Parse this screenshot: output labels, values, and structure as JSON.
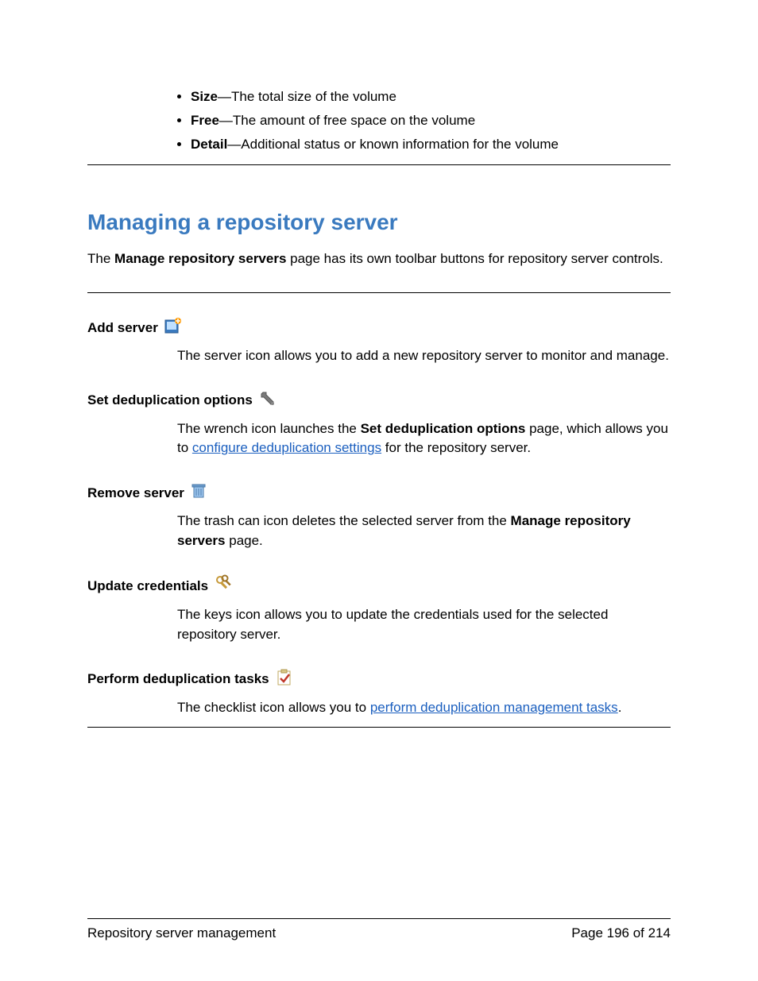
{
  "bullets": [
    {
      "term": "Size",
      "desc": "—The total size of the volume"
    },
    {
      "term": "Free",
      "desc": "—The amount of free space on the volume"
    },
    {
      "term": "Detail",
      "desc": "—Additional status or known information for the volume"
    }
  ],
  "heading": "Managing a repository server",
  "intro_prefix": "The ",
  "intro_bold": "Manage repository servers",
  "intro_suffix": " page has its own toolbar buttons for repository server controls.",
  "sections": {
    "add_server": {
      "title": "Add server",
      "desc": "The server icon allows you to add a new repository server to monitor and manage."
    },
    "set_dedup": {
      "title": "Set deduplication options",
      "desc_prefix": "The wrench icon launches the ",
      "desc_bold": "Set deduplication options",
      "desc_mid": " page, which allows you to ",
      "desc_link": "configure deduplication settings",
      "desc_suffix": " for the repository server."
    },
    "remove_server": {
      "title": "Remove server",
      "desc_prefix": "The trash can icon deletes the selected server from the ",
      "desc_bold": "Manage repository servers",
      "desc_suffix": " page."
    },
    "update_creds": {
      "title": "Update credentials",
      "desc": "The keys icon allows you to update the credentials used for the selected repository server."
    },
    "perform_dedup": {
      "title": "Perform deduplication tasks",
      "desc_prefix": "The checklist icon allows you to ",
      "desc_link": "perform deduplication management tasks",
      "desc_suffix": "."
    }
  },
  "footer": {
    "left": "Repository server management",
    "right": "Page 196 of 214"
  }
}
